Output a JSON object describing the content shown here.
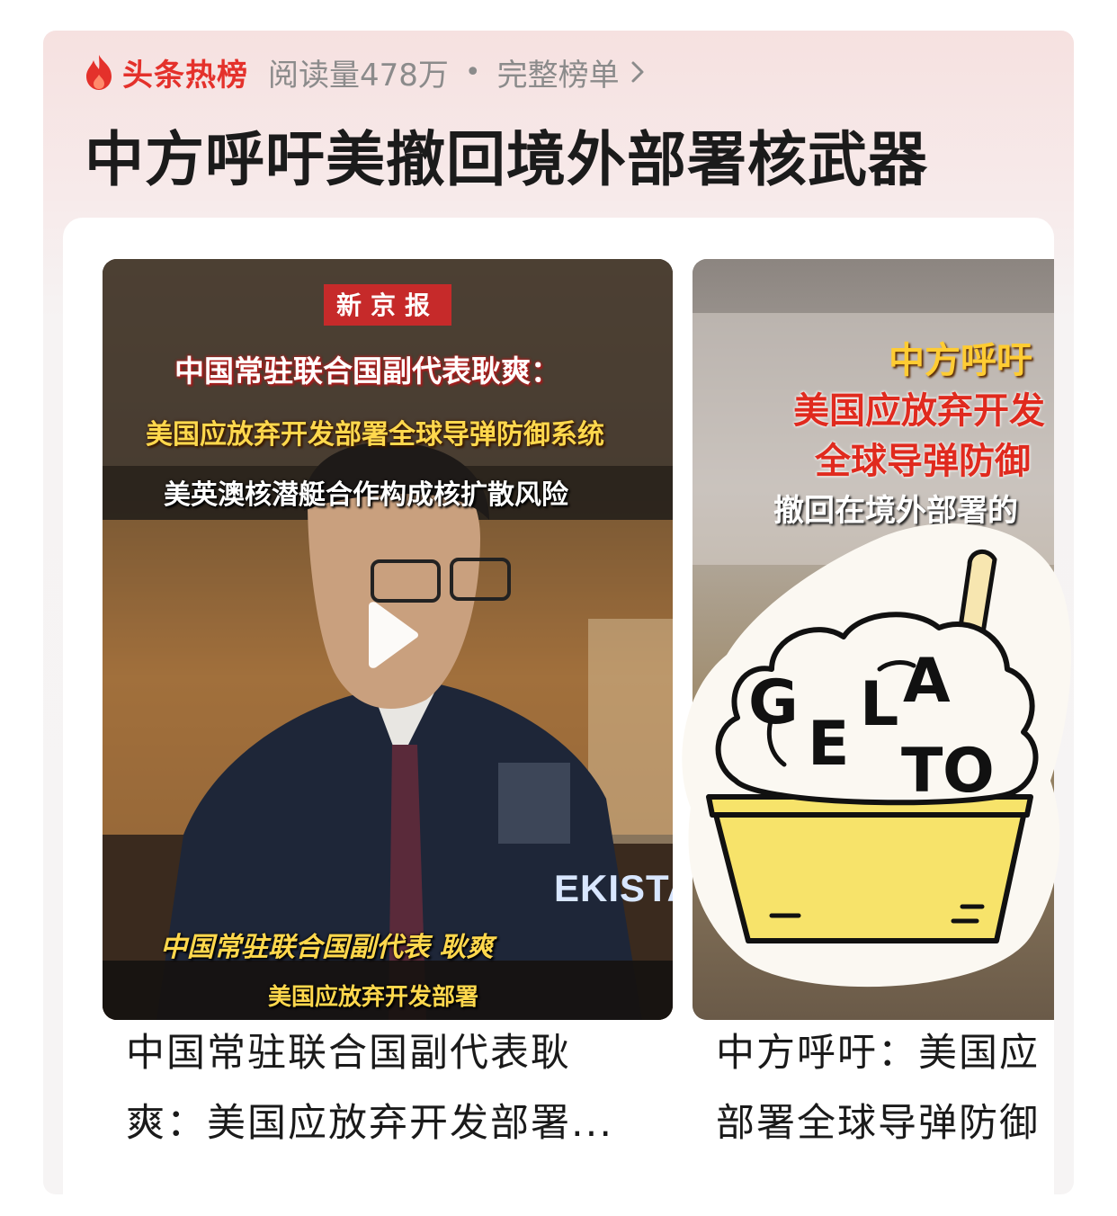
{
  "header": {
    "brand": "头条热榜",
    "reads": "阅读量478万",
    "separator": "•",
    "full_list": "完整榜单"
  },
  "headline": "中方呼吁美撤回境外部署核武器",
  "cards": [
    {
      "press_tag": "新京报",
      "overlay_line1": "中国常驻联合国副代表耿爽：",
      "overlay_line2": "美国应放弃开发部署全球导弹防御系统",
      "overlay_line3": "美英澳核潜艇合作构成核扩散风险",
      "nameplate": "EKISTAN",
      "subtitle_name": "中国常驻联合国副代表 耿爽",
      "subtitle_text": "美国应放弃开发部署",
      "caption_line1": "中国常驻联合国副代表耿",
      "caption_line2": "爽：美国应放弃开发部署..."
    },
    {
      "overlay_line1": "中方呼吁",
      "overlay_line2": "美国应放弃开发",
      "overlay_line3": "全球导弹防御",
      "overlay_line4": "撤回在境外部署的",
      "caption_line1": "中方呼吁：美国应",
      "caption_line2": "部署全球导弹防御"
    }
  ],
  "sticker": {
    "letters": [
      "G",
      "E",
      "L",
      "A",
      "T",
      "O"
    ],
    "cup_color": "#f7e36a"
  },
  "colors": {
    "brand_red": "#e4312b",
    "muted": "#8b8b8b",
    "headline": "#1b1b1b"
  }
}
